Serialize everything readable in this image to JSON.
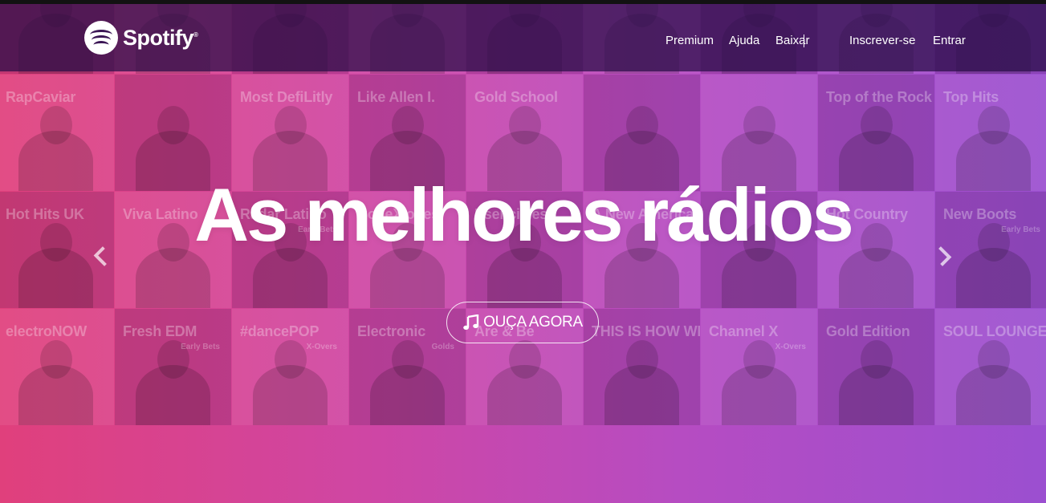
{
  "header": {
    "logo_text": "Spotify",
    "logo_reg": "®",
    "nav": [
      {
        "label": "Premium"
      },
      {
        "label": "Ajuda"
      },
      {
        "label": "Baixar"
      },
      {
        "label": "Inscrever-se"
      },
      {
        "label": "Entrar"
      }
    ]
  },
  "hero": {
    "headline": "As melhores rádios",
    "cta_label": "OUÇA AGORA",
    "cta_icon": "music-note-icon",
    "prev_icon": "chevron-left-icon",
    "next_icon": "chevron-right-icon"
  },
  "tiles": [
    {
      "title": "electroNOW",
      "sub": ""
    },
    {
      "title": "Fresh EDM",
      "sub": ""
    },
    {
      "title": "#dancePOP",
      "sub": "X-Overs"
    },
    {
      "title": "Electronic",
      "sub": "Golds"
    },
    {
      "title": "Are & Be",
      "sub": ""
    },
    {
      "title": "",
      "sub": ""
    },
    {
      "title": "Channel X",
      "sub": ""
    },
    {
      "title": "Gold Edition",
      "sub": ""
    },
    {
      "title": "",
      "sub": ""
    },
    {
      "title": "RapCaviar",
      "sub": ""
    },
    {
      "title": "",
      "sub": ""
    },
    {
      "title": "Most DefiLitly",
      "sub": ""
    },
    {
      "title": "Like Allen I.",
      "sub": ""
    },
    {
      "title": "Gold School",
      "sub": ""
    },
    {
      "title": "",
      "sub": ""
    },
    {
      "title": "",
      "sub": ""
    },
    {
      "title": "Top of the Rock",
      "sub": ""
    },
    {
      "title": "Top Hits",
      "sub": ""
    },
    {
      "title": "Hot Hits UK",
      "sub": ""
    },
    {
      "title": "Viva Latino",
      "sub": ""
    },
    {
      "title": "Radar Latino",
      "sub": "Early Bets"
    },
    {
      "title": "ConeXiones",
      "sub": ""
    },
    {
      "title": "Esenciales",
      "sub": ""
    },
    {
      "title": "A New America",
      "sub": ""
    },
    {
      "title": "",
      "sub": ""
    },
    {
      "title": "Hot Country",
      "sub": ""
    },
    {
      "title": "New Boots",
      "sub": "Early Bets"
    },
    {
      "title": "electroNOW",
      "sub": ""
    },
    {
      "title": "Fresh EDM",
      "sub": "Early Bets"
    },
    {
      "title": "#dancePOP",
      "sub": "X-Overs"
    },
    {
      "title": "Electronic",
      "sub": "Golds"
    },
    {
      "title": "Are & Be",
      "sub": ""
    },
    {
      "title": "THIS IS HOW WE DO",
      "sub": ""
    },
    {
      "title": "Channel X",
      "sub": "X-Overs"
    },
    {
      "title": "Gold Edition",
      "sub": ""
    },
    {
      "title": "SOUL LOUNGE",
      "sub": ""
    }
  ],
  "colors": {
    "gradient_left": "#e0407c",
    "gradient_right": "#9b4fd0",
    "header_bg": "#3b1655"
  }
}
